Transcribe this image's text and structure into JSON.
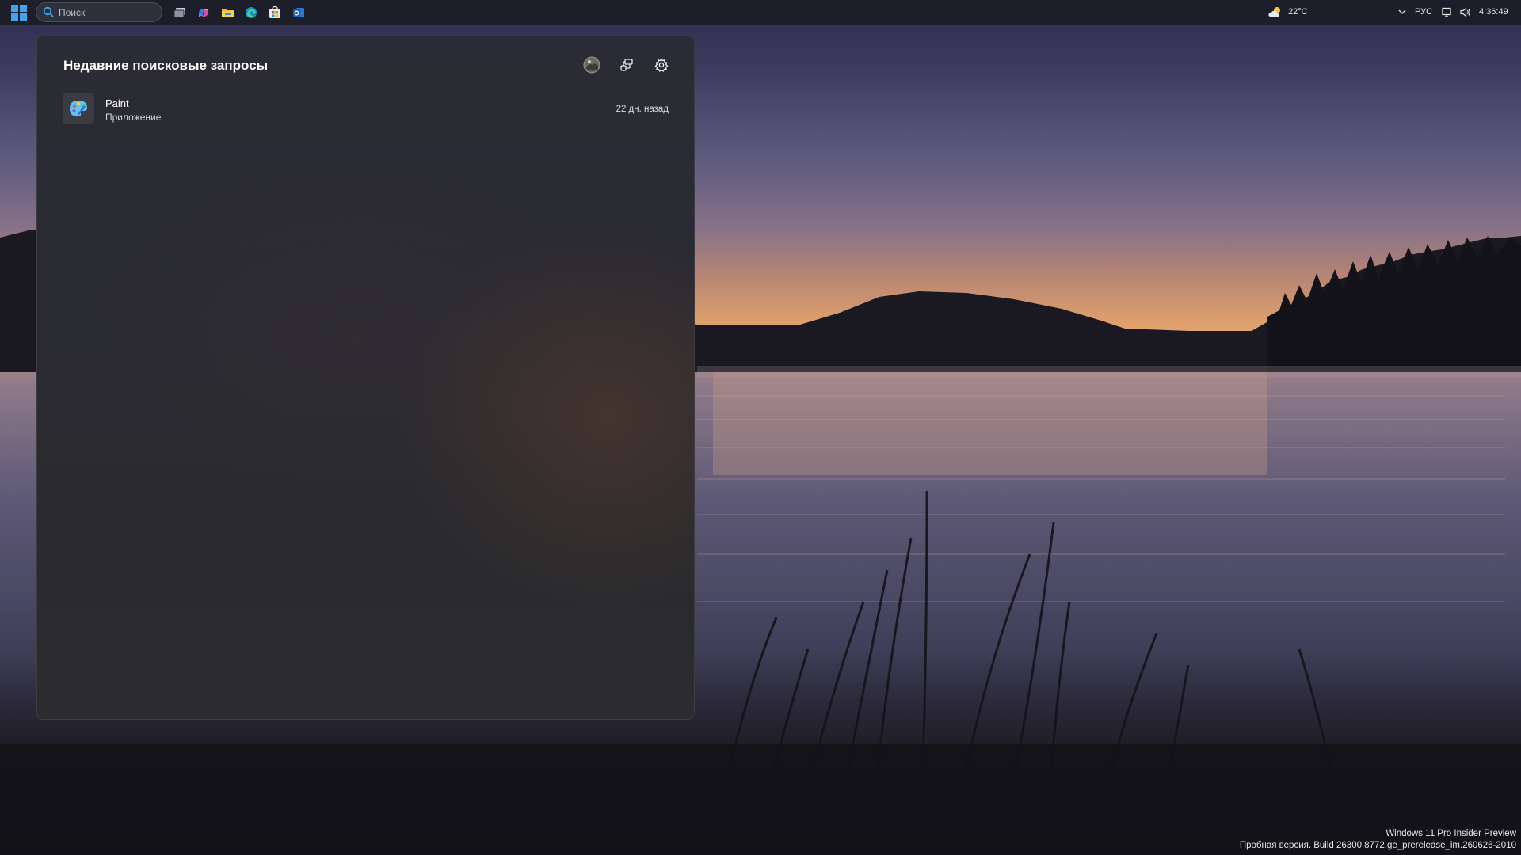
{
  "taskbar": {
    "search_placeholder": "Поиск",
    "pinned_apps": [
      "task-view-icon",
      "copilot-icon",
      "file-explorer-icon",
      "edge-icon",
      "store-icon",
      "outlook-icon"
    ],
    "weather": {
      "temperature": "22°C",
      "icon": "partly-cloudy-icon"
    },
    "language": "РУС",
    "clock": "4:36:49"
  },
  "search_panel": {
    "title": "Недавние поисковые запросы",
    "header_buttons": [
      "profile-avatar",
      "connected-devices-icon",
      "gear-icon"
    ],
    "recent": [
      {
        "name": "Paint",
        "kind": "Приложение",
        "time": "22 дн. назад",
        "icon": "paint-palette-icon"
      }
    ]
  },
  "watermark": {
    "line1": "Windows 11 Pro Insider Preview",
    "line2": "Пробная версия. Build 26300.8772.ge_prerelease_im.260626-2010"
  },
  "colors": {
    "taskbar_bg": "#1c1f29",
    "panel_bg": "#2b2b33",
    "accent": "#3ea3f0"
  }
}
